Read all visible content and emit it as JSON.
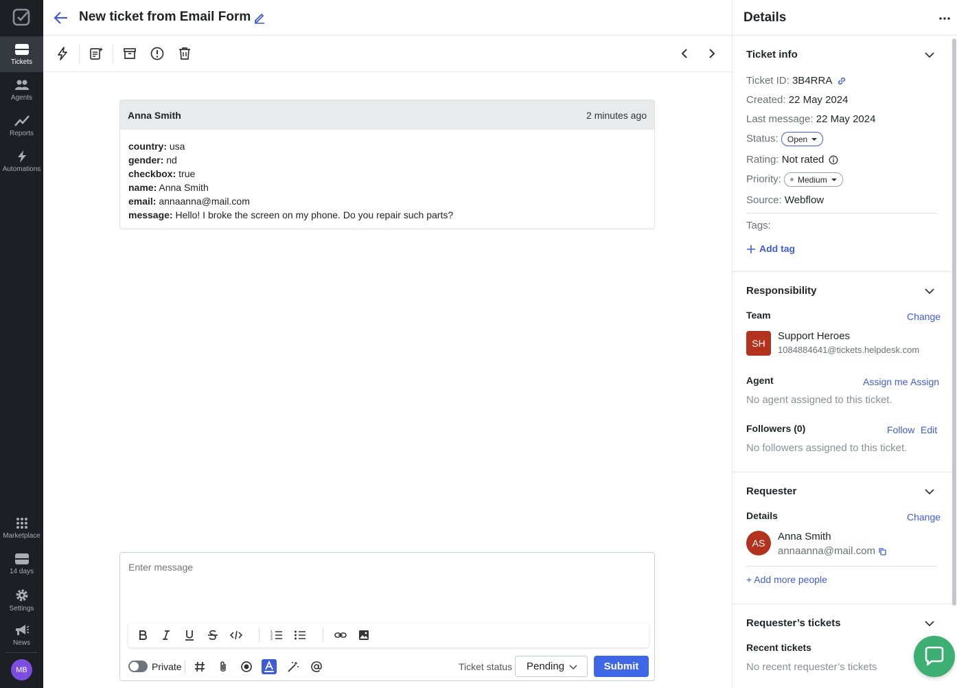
{
  "nav": {
    "items": [
      {
        "label": "Tickets"
      },
      {
        "label": "Agents"
      },
      {
        "label": "Reports"
      },
      {
        "label": "Automations"
      },
      {
        "label": "Marketplace"
      },
      {
        "label": "14 days"
      },
      {
        "label": "Settings"
      },
      {
        "label": "News"
      }
    ],
    "avatar": "MB"
  },
  "header": {
    "title": "New ticket from Email Form"
  },
  "message": {
    "from": "Anna Smith",
    "time": "2 minutes ago",
    "fields": [
      {
        "key": "country:",
        "value": " usa"
      },
      {
        "key": "gender:",
        "value": " nd"
      },
      {
        "key": "checkbox:",
        "value": " true"
      },
      {
        "key": "name:",
        "value": " Anna Smith"
      },
      {
        "key": "email:",
        "value": " annaanna@mail.com"
      },
      {
        "key": "message:",
        "value": " Hello! I broke the screen on my phone. Do you repair such parts?"
      }
    ]
  },
  "composer": {
    "placeholder": "Enter message",
    "private_label": "Private",
    "ticket_status_label": "Ticket status",
    "status_value": "Pending",
    "submit_label": "Submit"
  },
  "details": {
    "title": "Details",
    "ticket_info": {
      "title": "Ticket info",
      "ticket_id_label": "Ticket ID:",
      "ticket_id": "3B4RRA",
      "created_label": "Created:",
      "created": "22 May 2024",
      "last_message_label": "Last message:",
      "last_message": "22 May 2024",
      "status_label": "Status:",
      "status": "Open",
      "rating_label": "Rating:",
      "rating": "Not rated",
      "priority_label": "Priority:",
      "priority": "Medium",
      "source_label": "Source:",
      "source": "Webflow",
      "tags_label": "Tags:",
      "add_tag": "Add tag"
    },
    "responsibility": {
      "title": "Responsibility",
      "team_label": "Team",
      "change": "Change",
      "team_initials": "SH",
      "team_name": "Support Heroes",
      "team_email": "1084884641@tickets.helpdesk.com",
      "agent_label": "Agent",
      "assign_me": "Assign me",
      "assign": "Assign",
      "no_agent": "No agent assigned to this ticket.",
      "followers_label": "Followers (0)",
      "follow": "Follow",
      "edit": "Edit",
      "no_followers": "No followers assigned to this ticket."
    },
    "requester": {
      "title": "Requester",
      "details_label": "Details",
      "change": "Change",
      "initials": "AS",
      "name": "Anna Smith",
      "email": "annaanna@mail.com",
      "add_more": "+ Add more people"
    },
    "requester_tickets": {
      "title": "Requester’s tickets",
      "recent_label": "Recent tickets",
      "none": "No recent requester’s tickets"
    }
  },
  "colors": {
    "accent": "#3e5bd8",
    "rail": "#1c1f24",
    "avatar": "#b3321e",
    "chat": "#3eaf73"
  }
}
